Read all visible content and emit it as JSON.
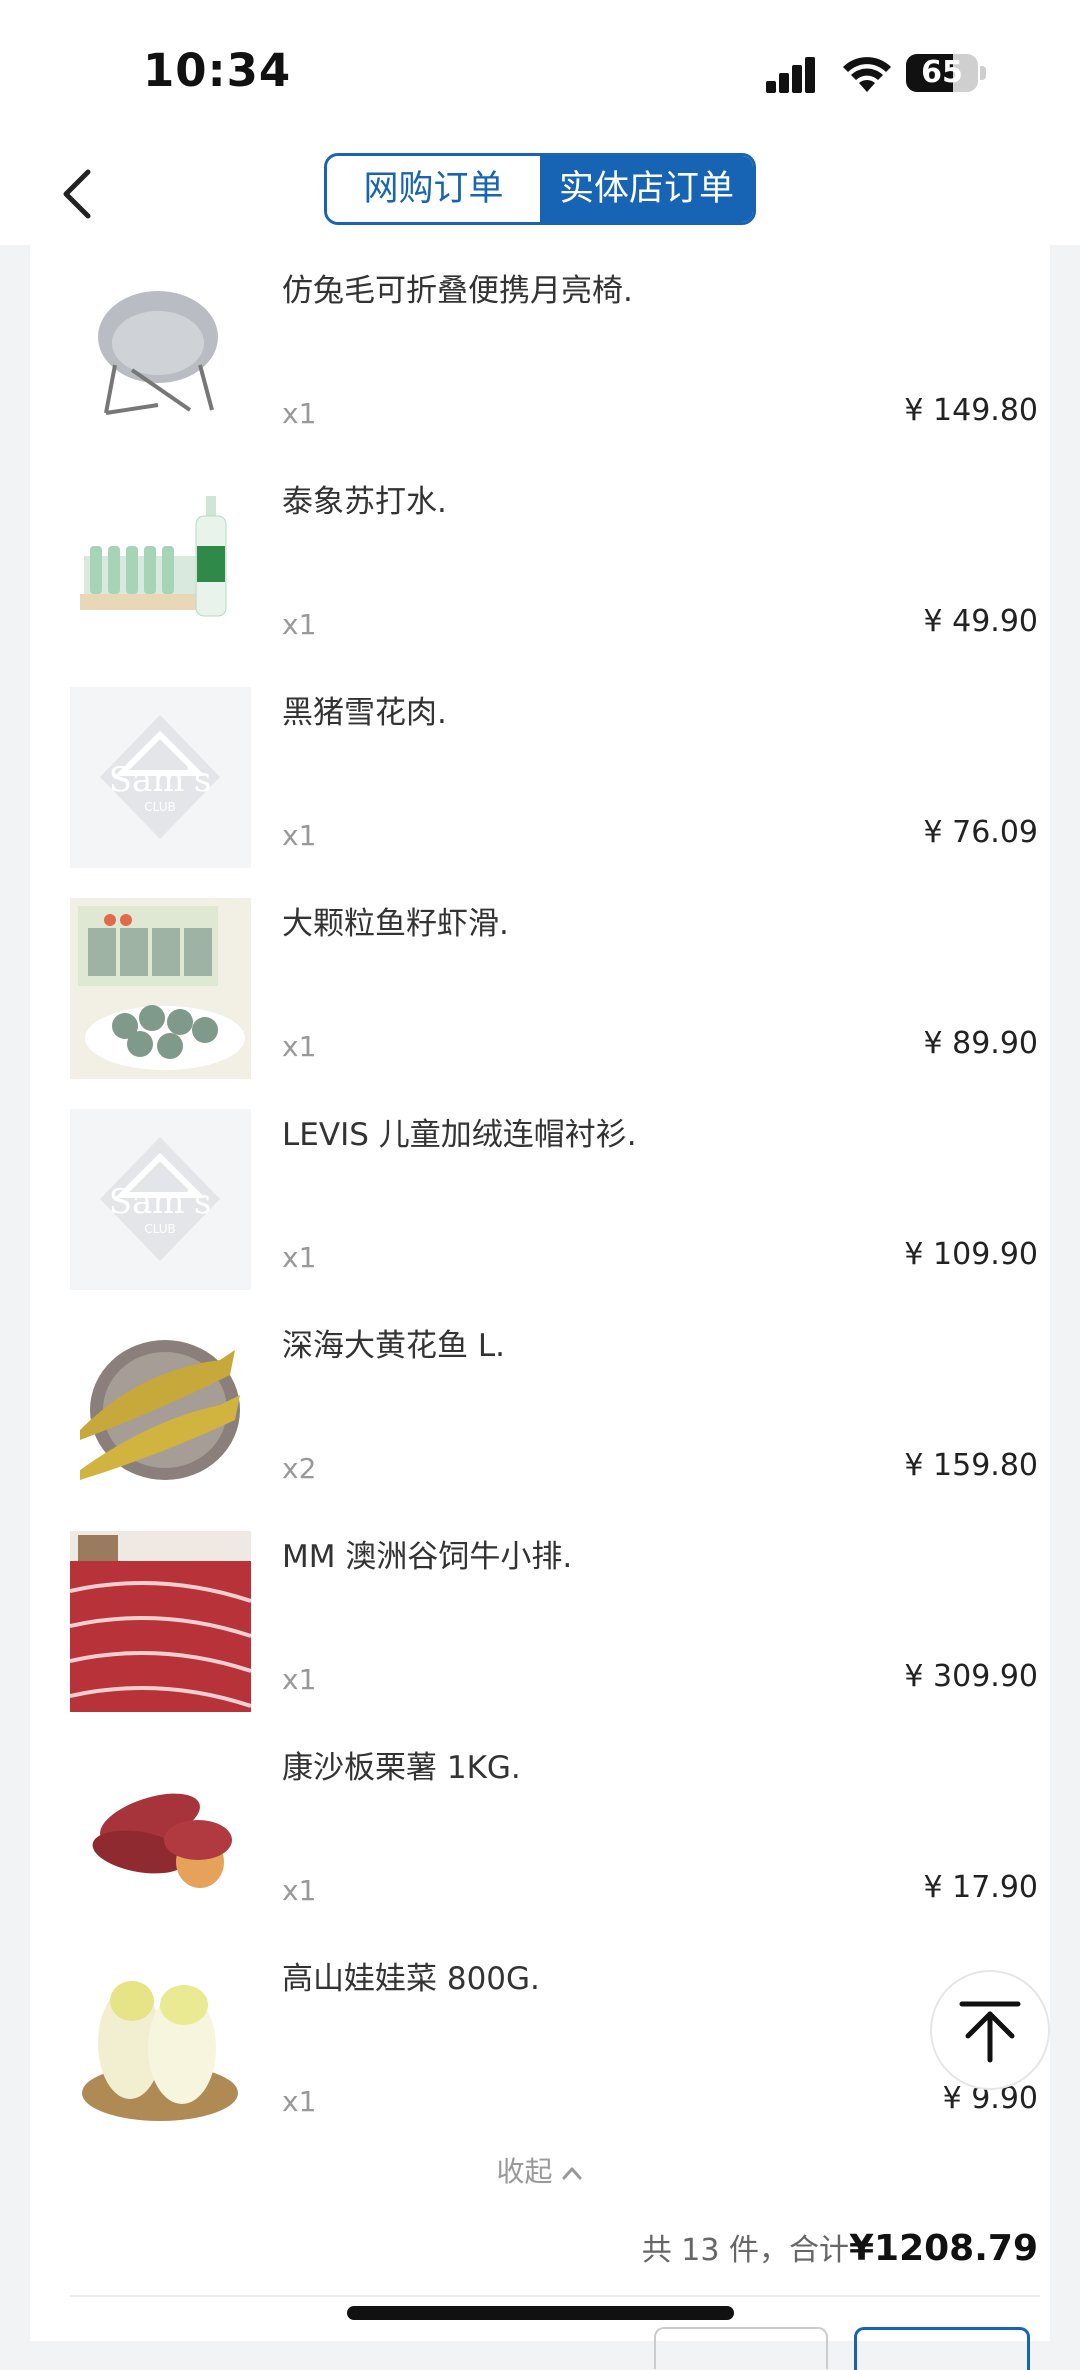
{
  "status_bar": {
    "time": "10:34",
    "battery": "65",
    "battery_level_percent": 65
  },
  "header": {
    "tabs": [
      {
        "label": "网购订单",
        "active": false
      },
      {
        "label": "实体店订单",
        "active": true
      }
    ]
  },
  "items": [
    {
      "name": "仿兔毛可折叠便携月亮椅.",
      "qty": "x1",
      "price": "¥ 149.80",
      "icon": "moon-chair-image"
    },
    {
      "name": "泰象苏打水.",
      "qty": "x1",
      "price": "¥ 49.90",
      "icon": "soda-water-image"
    },
    {
      "name": "黑猪雪花肉.",
      "qty": "x1",
      "price": "¥ 76.09",
      "icon": "sams-club-placeholder-image"
    },
    {
      "name": "大颗粒鱼籽虾滑.",
      "qty": "x1",
      "price": "¥ 89.90",
      "icon": "shrimp-paste-image"
    },
    {
      "name": "LEVIS 儿童加绒连帽衬衫.",
      "qty": "x1",
      "price": "¥ 109.90",
      "icon": "sams-club-placeholder-image"
    },
    {
      "name": "深海大黄花鱼 L.",
      "qty": "x2",
      "price": "¥ 159.80",
      "icon": "yellow-croaker-image"
    },
    {
      "name": "MM 澳洲谷饲牛小排.",
      "qty": "x1",
      "price": "¥ 309.90",
      "icon": "beef-ribs-image"
    },
    {
      "name": "康沙板栗薯 1KG.",
      "qty": "x1",
      "price": "¥ 17.90",
      "icon": "sweet-potato-image"
    },
    {
      "name": "高山娃娃菜 800G.",
      "qty": "x1",
      "price": "¥ 9.90",
      "icon": "baby-cabbage-image"
    }
  ],
  "placeholder_logo": {
    "brand": "Sam's",
    "sub": "CLUB"
  },
  "collapse_label": "收起",
  "summary": {
    "prefix": "共 13 件，合计",
    "total": "¥1208.79"
  },
  "colors": {
    "accent": "#1664b3",
    "background": "#f2f3f5",
    "card": "#ffffff"
  }
}
